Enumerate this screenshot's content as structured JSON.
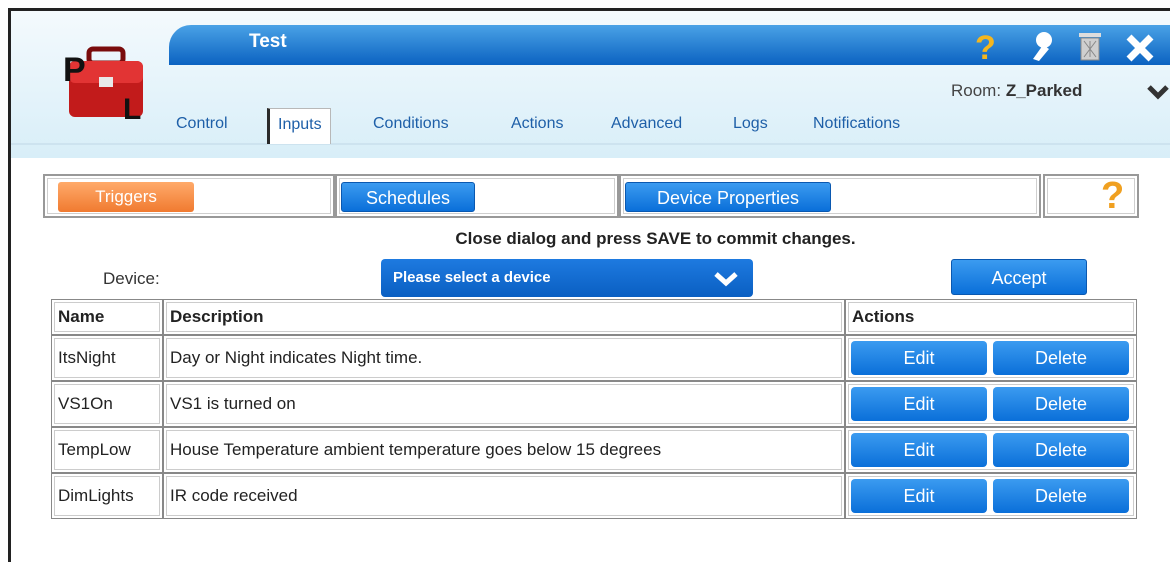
{
  "window": {
    "title": "Test"
  },
  "header": {
    "room_label": "Room:",
    "room_value": "Z_Parked",
    "icons": [
      "help-icon",
      "settings-icon",
      "trash-icon",
      "close-icon"
    ],
    "logo_letters": [
      "P",
      "L"
    ]
  },
  "tabs": [
    {
      "label": "Control",
      "active": false
    },
    {
      "label": "Inputs",
      "active": true
    },
    {
      "label": "Conditions",
      "active": false
    },
    {
      "label": "Actions",
      "active": false
    },
    {
      "label": "Advanced",
      "active": false
    },
    {
      "label": "Logs",
      "active": false
    },
    {
      "label": "Notifications",
      "active": false
    }
  ],
  "subtabs": {
    "triggers": "Triggers",
    "schedules": "Schedules",
    "device_properties": "Device Properties",
    "help": "?"
  },
  "notice": "Close dialog and press SAVE to commit changes.",
  "device": {
    "label": "Device:",
    "placeholder": "Please select a device",
    "accept": "Accept"
  },
  "table": {
    "headers": [
      "Name",
      "Description",
      "Actions"
    ],
    "rows": [
      {
        "name": "ItsNight",
        "description": "Day or Night indicates Night time.",
        "edit": "Edit",
        "delete": "Delete"
      },
      {
        "name": "VS1On",
        "description": "VS1 is turned on",
        "edit": "Edit",
        "delete": "Delete"
      },
      {
        "name": "TempLow",
        "description": "House Temperature ambient temperature goes below 15 degrees",
        "edit": "Edit",
        "delete": "Delete"
      },
      {
        "name": "DimLights",
        "description": "IR code received",
        "edit": "Edit",
        "delete": "Delete"
      }
    ]
  },
  "colors": {
    "accent_blue": "#0a6fd9",
    "triggers_orange": "#f07a30",
    "help_yellow": "#f0a020"
  }
}
